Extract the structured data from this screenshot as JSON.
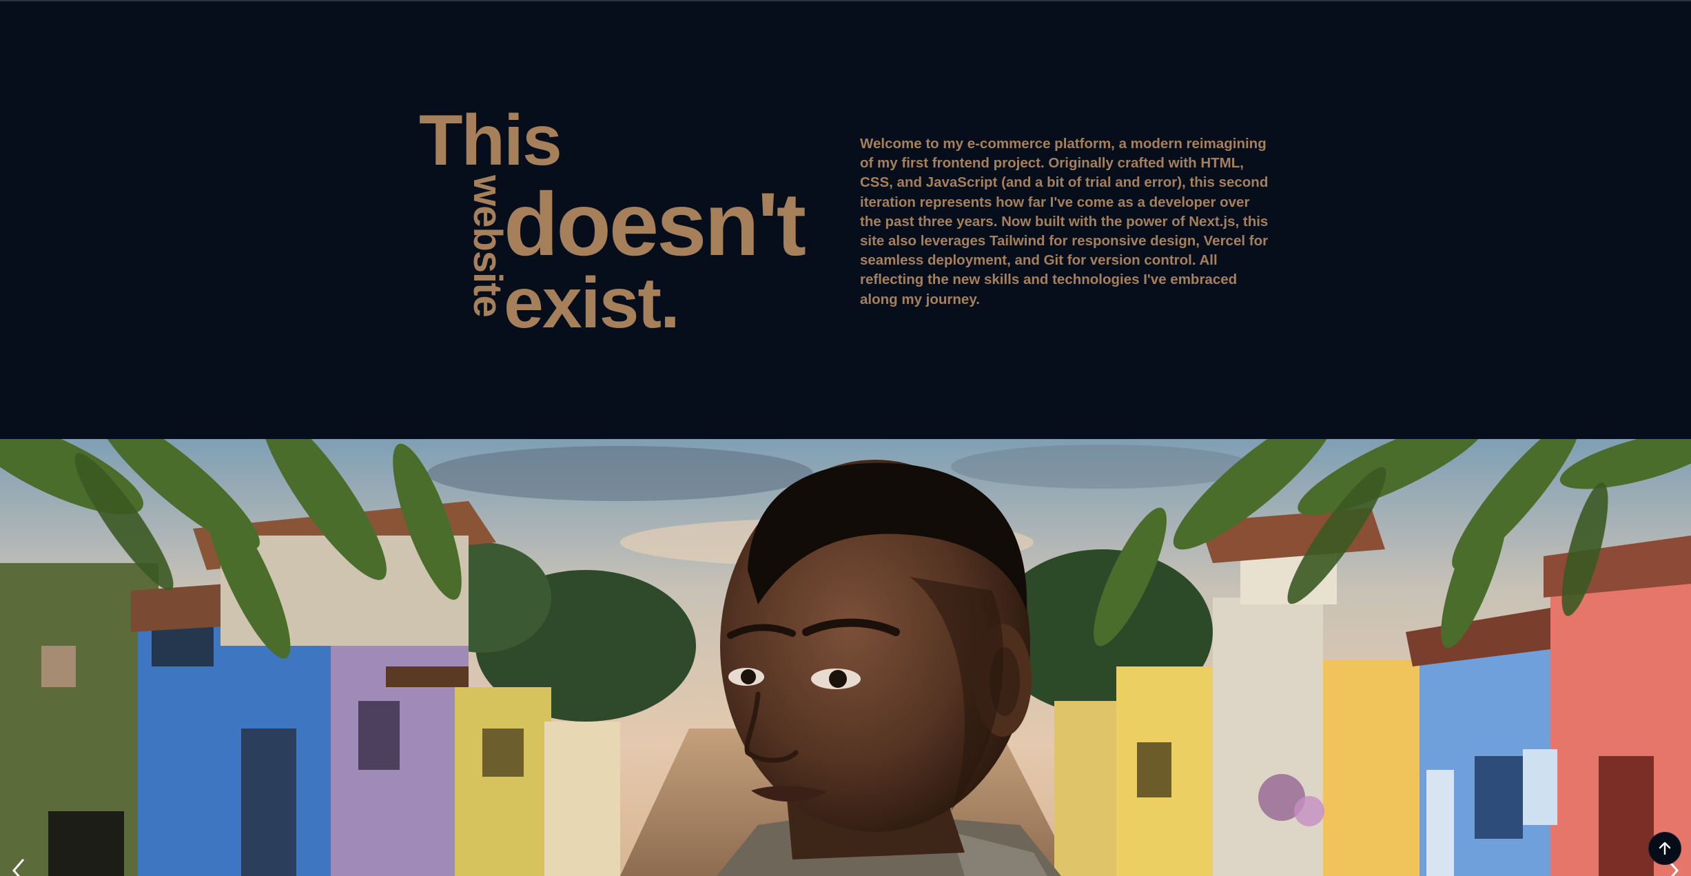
{
  "hero": {
    "headline": {
      "word_this": "This",
      "word_website": "website",
      "word_doesnt": "doesn't",
      "word_exist": "exist."
    },
    "intro": "Welcome to my e-commerce platform, a modern reimagining of my first frontend project. Originally crafted with HTML, CSS, and JavaScript (and a bit of trial and error), this second iteration represents how far I've come as a developer over the past three years. Now built with the power of Next.js, this site also leverages Tailwind for responsive design, Vercel for seamless deployment, and Git for version control. All reflecting the new skills and technologies I've embraced along my journey.",
    "accent_color": "#a6805a",
    "background_color": "#060e1c"
  },
  "carousel": {
    "image_icon": "portrait-photo",
    "prev_icon": "chevron-left-icon",
    "next_icon": "chevron-right-icon"
  },
  "scroll_top": {
    "icon": "arrow-up-icon"
  }
}
